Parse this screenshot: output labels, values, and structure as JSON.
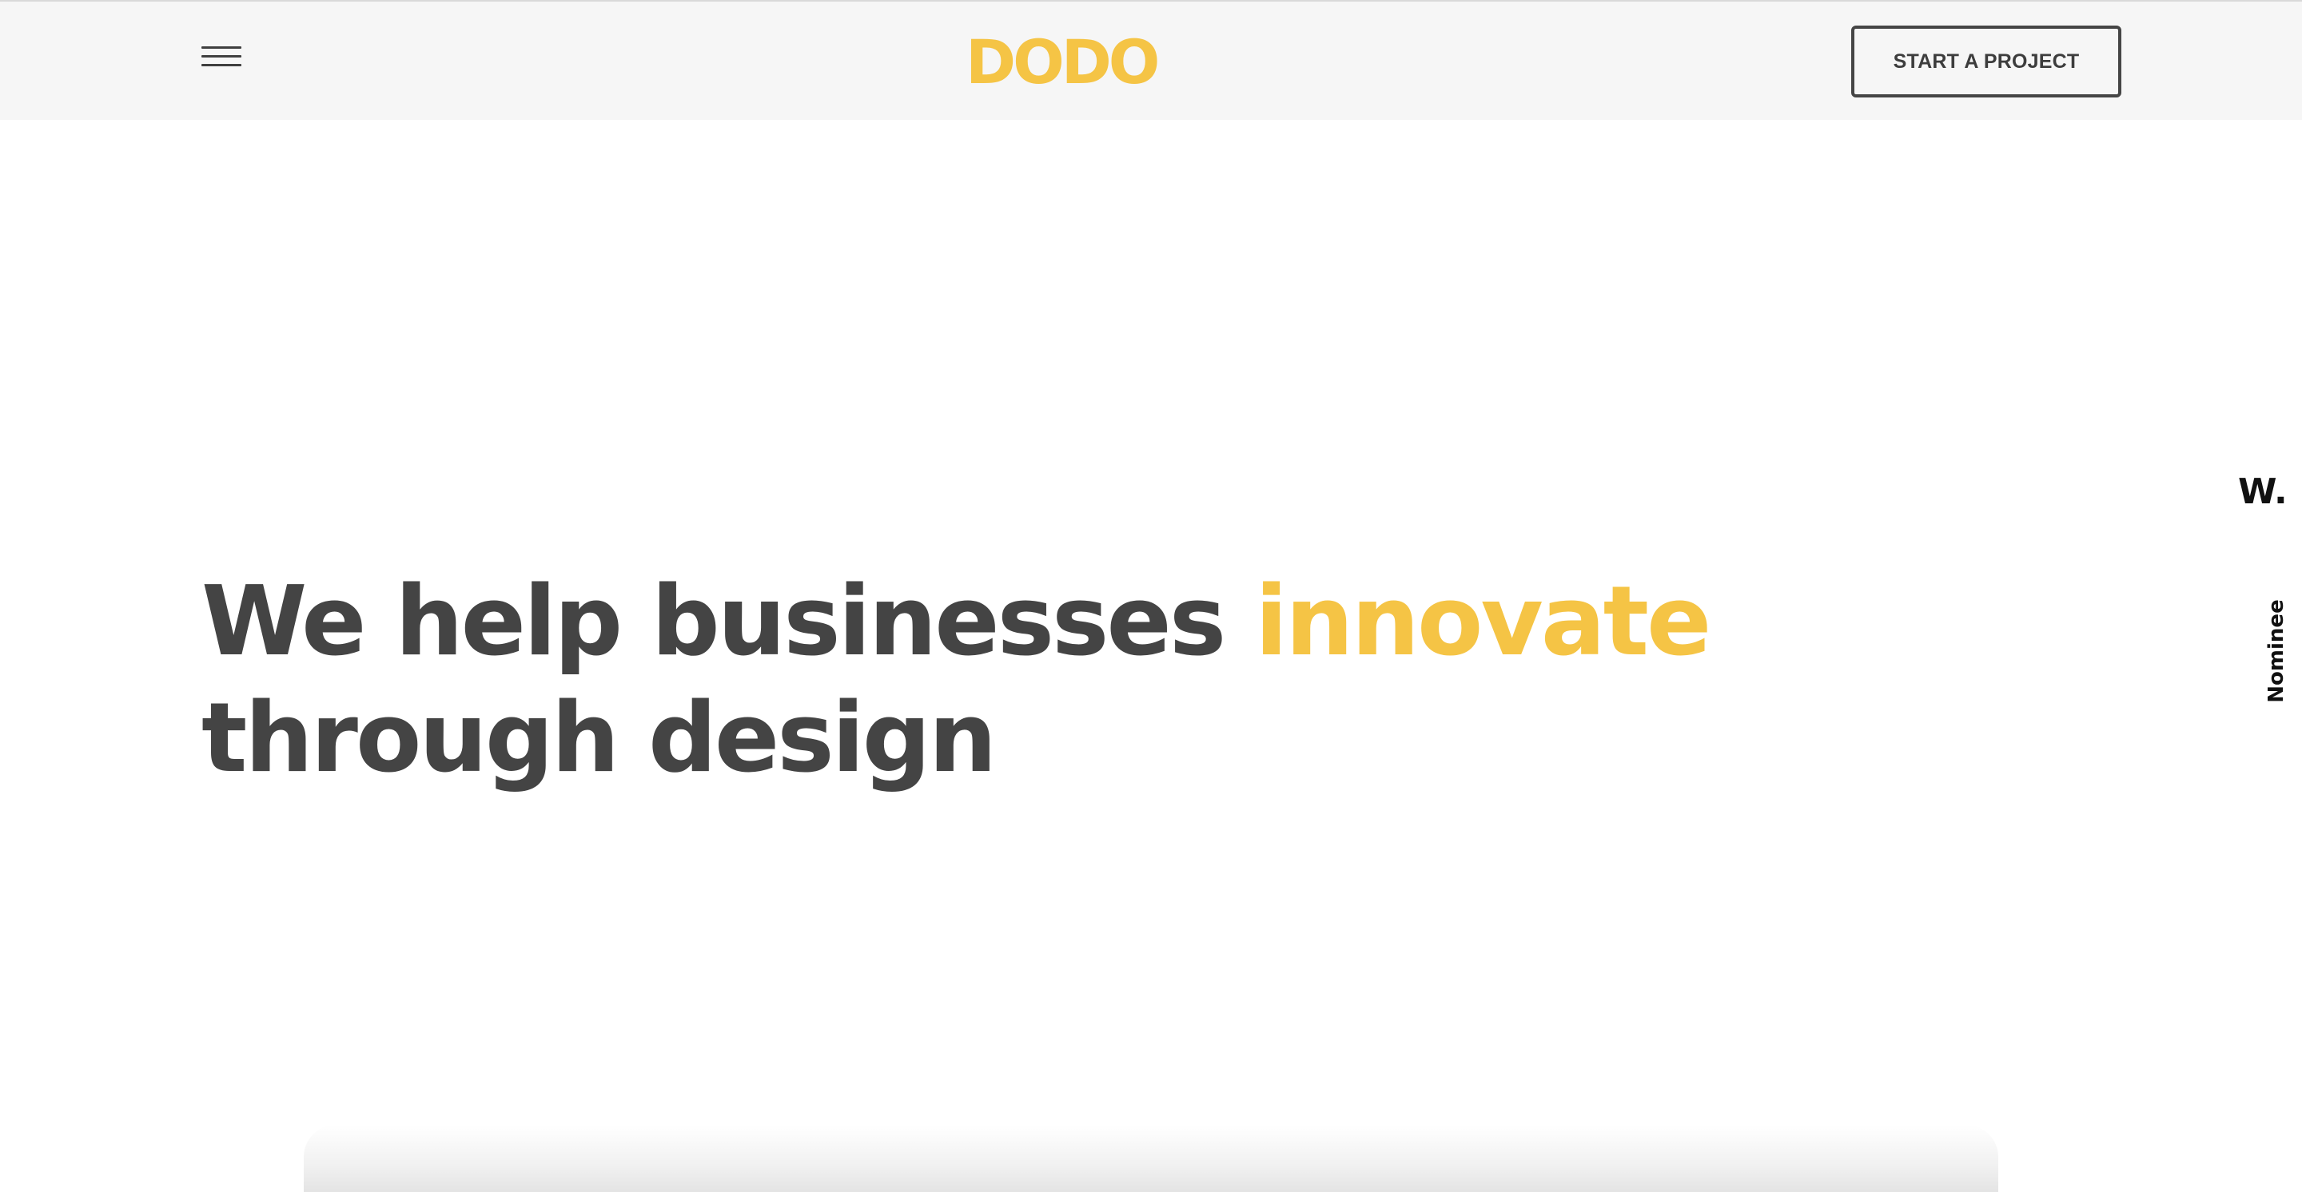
{
  "header": {
    "menu_icon": "hamburger-icon",
    "logo_text": "DODO",
    "cta_label": "START A PROJECT"
  },
  "hero": {
    "title_before": "We help businesses ",
    "title_accent": "innovate",
    "title_after": "through design"
  },
  "award": {
    "logo_text": "W.",
    "label": "Nominee"
  },
  "colors": {
    "accent": "#f5c445",
    "text": "#444444",
    "header_bg": "#f6f6f6"
  }
}
